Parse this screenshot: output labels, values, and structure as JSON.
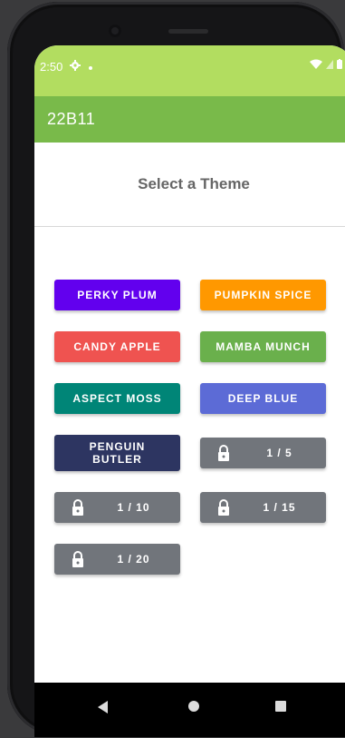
{
  "status": {
    "time": "2:50",
    "settings_icon": "gear-icon",
    "dot_icon": "notification-dot-icon",
    "wifi_icon": "wifi-icon",
    "signal_icon": "cell-signal-icon",
    "battery_icon": "battery-icon"
  },
  "appbar": {
    "title": "22B11"
  },
  "header": {
    "title": "Select a Theme"
  },
  "themes": [
    {
      "label": "PERKY PLUM",
      "color": "#6200ee",
      "locked": false
    },
    {
      "label": "PUMPKIN SPICE",
      "color": "#ff9800",
      "locked": false
    },
    {
      "label": "CANDY APPLE",
      "color": "#ef5350",
      "locked": false
    },
    {
      "label": "MAMBA MUNCH",
      "color": "#6ab04c",
      "locked": false
    },
    {
      "label": "ASPECT MOSS",
      "color": "#008577",
      "locked": false
    },
    {
      "label": "DEEP BLUE",
      "color": "#5c6bd6",
      "locked": false
    },
    {
      "label": "PENGUIN BUTLER",
      "color": "#2d3561",
      "locked": false
    },
    {
      "label": "1 / 5",
      "color": "#71757b",
      "locked": true
    },
    {
      "label": "1 / 10",
      "color": "#71757b",
      "locked": true
    },
    {
      "label": "1 / 15",
      "color": "#71757b",
      "locked": true
    },
    {
      "label": "1 / 20",
      "color": "#71757b",
      "locked": true
    }
  ],
  "nav": {
    "back_icon": "back-triangle-icon",
    "home_icon": "home-circle-icon",
    "recent_icon": "recents-square-icon"
  }
}
